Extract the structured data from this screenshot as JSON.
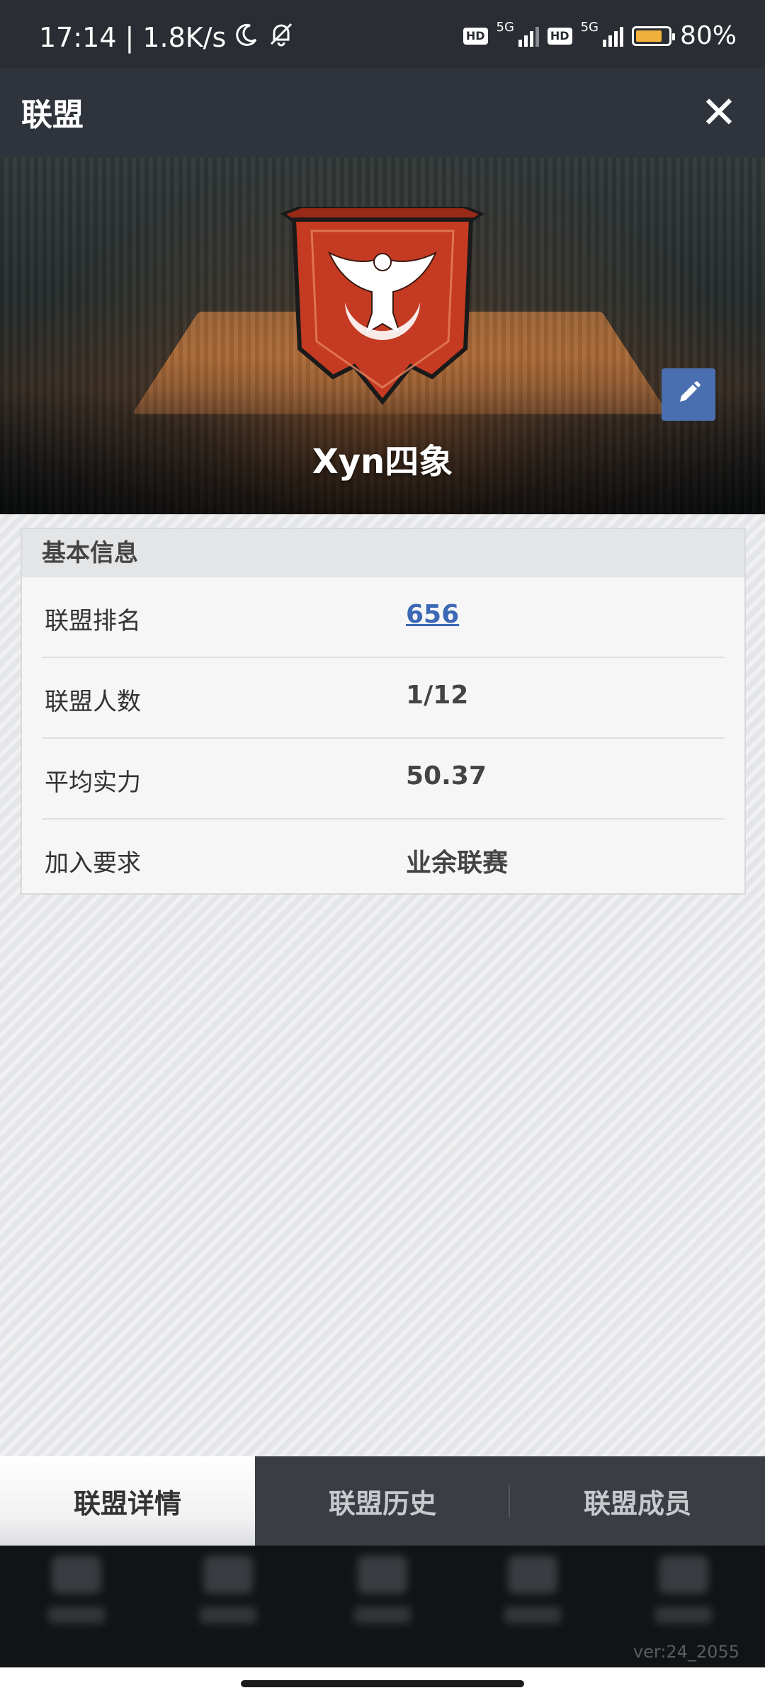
{
  "status_bar": {
    "time": "17:14",
    "separator": "|",
    "net_speed": "1.8K/s",
    "hd1": "HD",
    "net1": "5G",
    "hd2": "HD",
    "net2": "5G",
    "battery": "80%"
  },
  "header": {
    "title": "联盟",
    "close_label": "✕"
  },
  "hero": {
    "team_name": "Xyn四象"
  },
  "info_card": {
    "title": "基本信息",
    "rows": [
      {
        "label": "联盟排名",
        "value": "656"
      },
      {
        "label": "联盟人数",
        "value": "1/12"
      },
      {
        "label": "平均实力",
        "value": "50.37"
      },
      {
        "label": "加入要求",
        "value": "业余联赛"
      }
    ]
  },
  "tabs": [
    {
      "label": "联盟详情"
    },
    {
      "label": "联盟历史"
    },
    {
      "label": "联盟成员"
    }
  ],
  "footer": {
    "version": "ver:24_2055"
  },
  "colors": {
    "accent_link": "#3c68b5",
    "edit_button": "#4a6fb0",
    "emblem_red": "#c53a22"
  }
}
